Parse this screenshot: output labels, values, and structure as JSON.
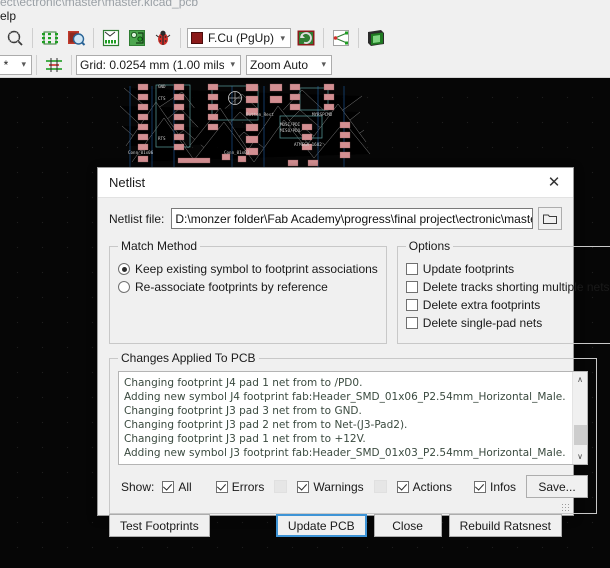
{
  "window": {
    "title": "ect\\ectronic\\master\\master.kicad_pcb",
    "menu": "elp"
  },
  "toolbar": {
    "icons": [
      {
        "name": "zoom-area-icon"
      },
      {
        "name": "footprint-editor-icon"
      },
      {
        "name": "footprint-inspect-icon"
      },
      {
        "name": "netlist-icon"
      },
      {
        "name": "update-pcb-icon"
      },
      {
        "name": "drc-bug-icon"
      },
      {
        "name": "highlight-net-icon"
      },
      {
        "name": "3d-viewer-icon"
      }
    ],
    "layer_value": "F.Cu (PgUp)",
    "layer_color": "#8b1a1a",
    "units_value": "mils) *",
    "grid_value": "Grid: 0.0254 mm (1.00 mils)",
    "zoom_value": "Zoom Auto"
  },
  "dialog": {
    "title": "Netlist",
    "close_glyph": "✕",
    "file_label": "Netlist file:",
    "file_value": "D:\\monzer folder\\Fab Academy\\progress\\final project\\ectronic\\master\\master.net",
    "browse_icon": "folder-icon",
    "match_method": {
      "legend": "Match Method",
      "options": [
        {
          "label": "Keep existing symbol to footprint associations",
          "selected": true
        },
        {
          "label": "Re-associate footprints by reference",
          "selected": false
        }
      ]
    },
    "options": {
      "legend": "Options",
      "items": [
        {
          "label": "Update footprints",
          "checked": false
        },
        {
          "label": "Delete tracks shorting multiple nets",
          "checked": false
        },
        {
          "label": "Delete extra footprints",
          "checked": false
        },
        {
          "label": "Delete single-pad nets",
          "checked": false
        }
      ]
    },
    "changes": {
      "legend": "Changes Applied To PCB",
      "lines": [
        "Changing footprint J4 pad 1 net from to /PD0.",
        "Adding new symbol J4 footprint fab:Header_SMD_01x06_P2.54mm_Horizontal_Male.",
        "Changing footprint J3 pad 3 net from to GND.",
        "Changing footprint J3 pad 2 net from to Net-(J3-Pad2).",
        "Changing footprint J3 pad 1 net from to +12V.",
        "Adding new symbol J3 footprint fab:Header_SMD_01x03_P2.54mm_Horizontal_Male."
      ],
      "scroll_up_glyph": "∧",
      "scroll_down_glyph": "∨"
    },
    "show": {
      "label": "Show:",
      "filters": [
        {
          "label": "All",
          "checked": true
        },
        {
          "label": "Errors",
          "checked": true
        },
        {
          "label": "Warnings",
          "checked": true
        },
        {
          "label": "Actions",
          "checked": true
        },
        {
          "label": "Infos",
          "checked": true
        }
      ],
      "save_label": "Save..."
    },
    "buttons": {
      "test_footprints": "Test Footprints",
      "update_pcb": "Update PCB",
      "close": "Close",
      "rebuild_ratsnest": "Rebuild Ratsnest"
    },
    "focus_color": "#3e94d6"
  },
  "canvas": {
    "texts": [
      "GND",
      "CTS",
      "RTS",
      "Button_Rest",
      "MOSI/PDI",
      "MISO/PDO",
      "MYRSPCMD",
      "ATMEGA-16U2",
      "Conn_01x06",
      "Conn_01x03"
    ]
  }
}
